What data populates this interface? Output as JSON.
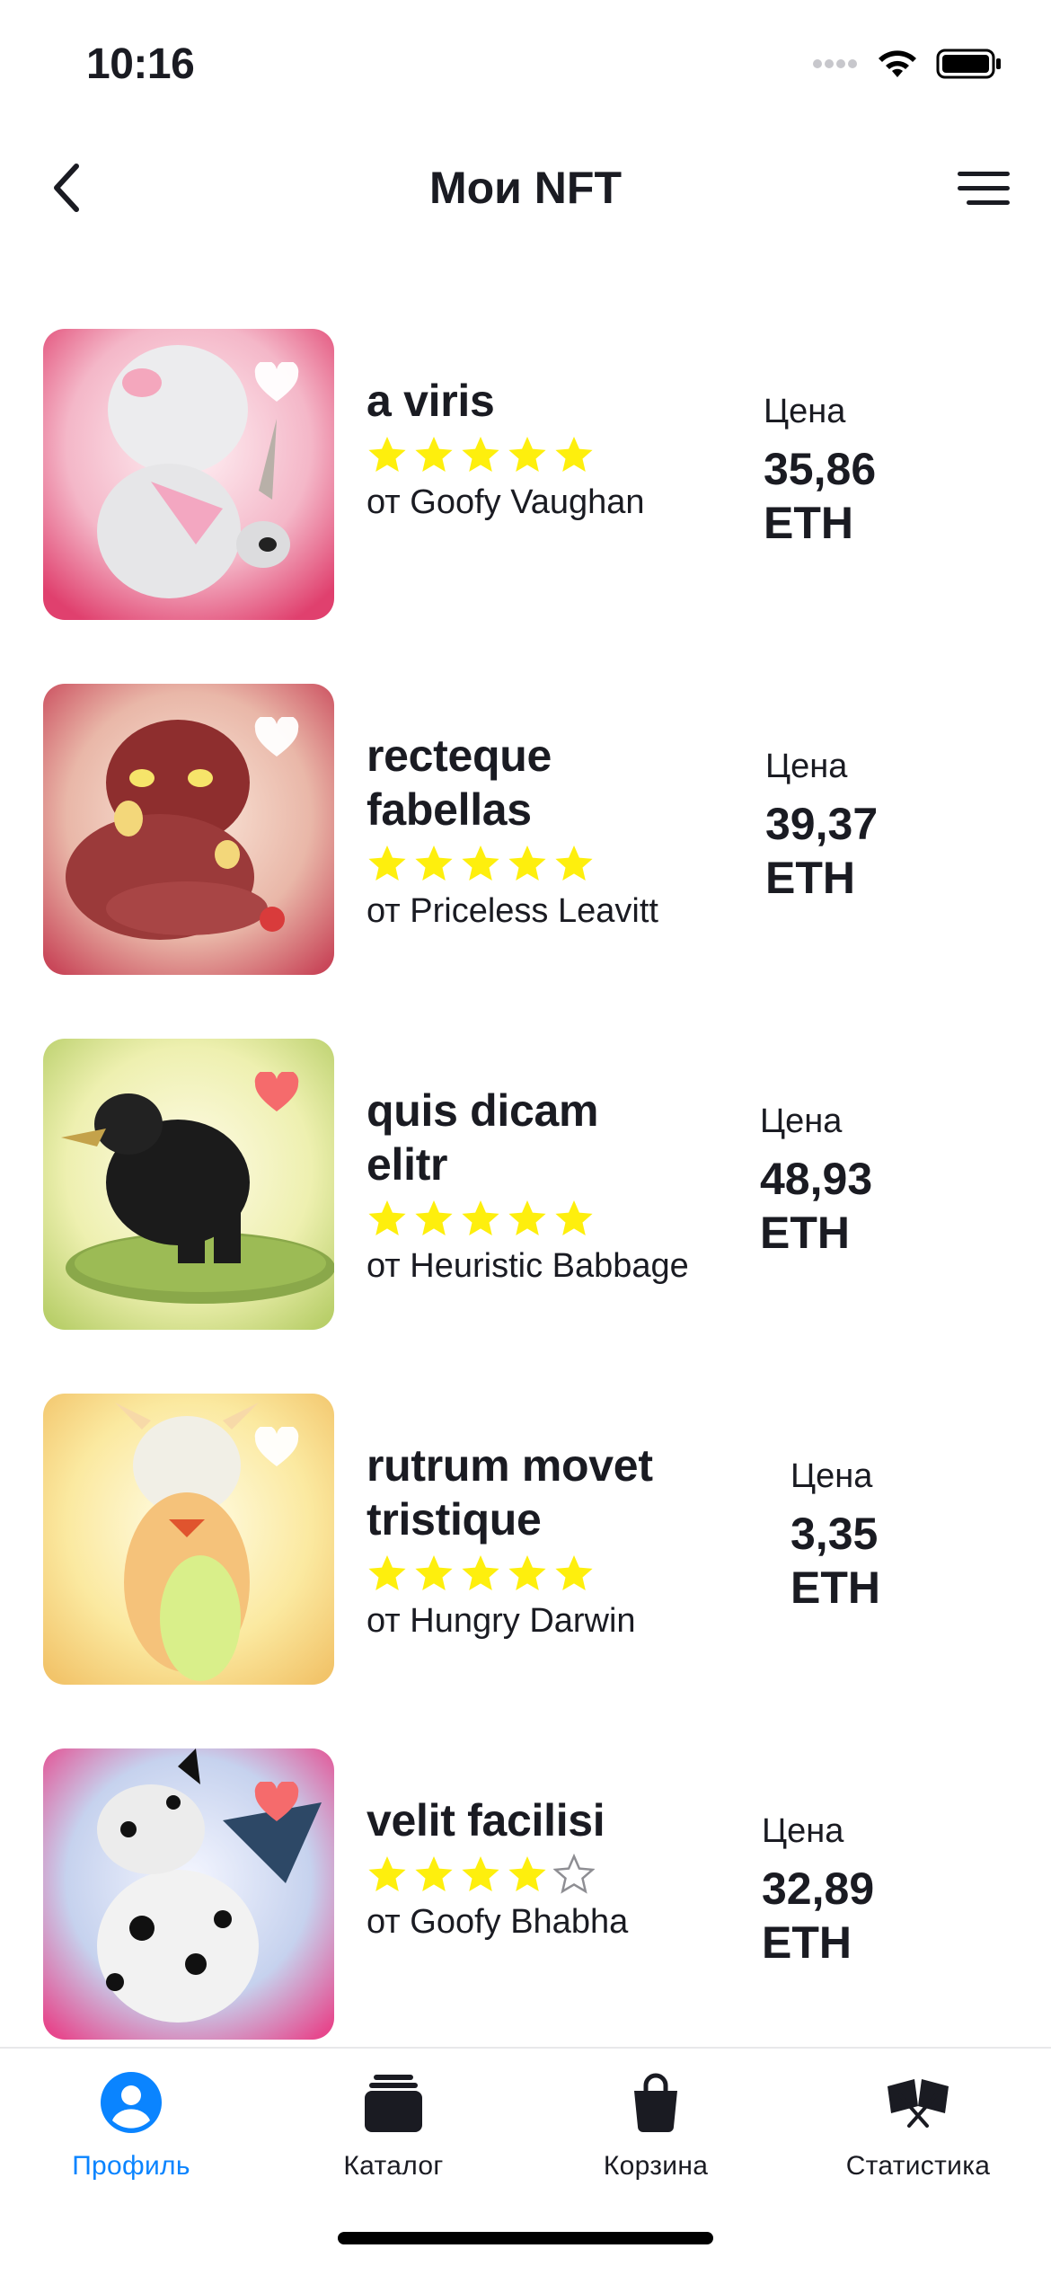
{
  "status_bar": {
    "time": "10:16"
  },
  "nav": {
    "title": "Мои NFT"
  },
  "colors": {
    "accent": "#0A84FF",
    "star": "#FEEF0D",
    "star_empty": "#8E8E93",
    "like_active": "#F56B6C",
    "like_inactive": "#FFFFFF",
    "text": "#1A1B22"
  },
  "price_label": "Цена",
  "nfts": [
    {
      "name": "a viris",
      "rating": 5,
      "author": "от Goofy Vaughan",
      "price": "35,86 ETH",
      "liked": false
    },
    {
      "name": "recteque fabellas",
      "rating": 5,
      "author": "от Priceless Leavitt",
      "price": "39,37 ETH",
      "liked": false
    },
    {
      "name": "quis dicam elitr",
      "rating": 5,
      "author": "от Heuristic Babbage",
      "price": "48,93 ETH",
      "liked": true
    },
    {
      "name": "rutrum movet tristique",
      "rating": 5,
      "author": "от Hungry Darwin",
      "price": "3,35 ETH",
      "liked": false
    },
    {
      "name": "velit facilisi",
      "rating": 4,
      "author": "от Goofy Bhabha",
      "price": "32,89 ETH",
      "liked": true
    }
  ],
  "tabs": [
    {
      "label": "Профиль",
      "icon": "profile-icon",
      "active": true
    },
    {
      "label": "Каталог",
      "icon": "catalog-icon",
      "active": false
    },
    {
      "label": "Корзина",
      "icon": "cart-icon",
      "active": false
    },
    {
      "label": "Статистика",
      "icon": "statistics-icon",
      "active": false
    }
  ]
}
